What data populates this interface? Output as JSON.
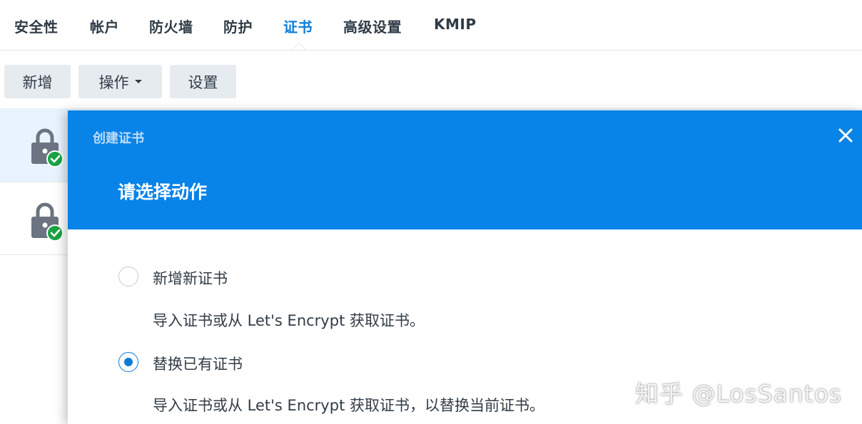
{
  "tabs": [
    {
      "label": "安全性"
    },
    {
      "label": "帐户"
    },
    {
      "label": "防火墙"
    },
    {
      "label": "防护"
    },
    {
      "label": "证书",
      "active": true
    },
    {
      "label": "高级设置"
    },
    {
      "label": "KMIP"
    }
  ],
  "toolbar": {
    "add_label": "新增",
    "action_label": "操作",
    "settings_label": "设置"
  },
  "list": {
    "items": [
      {
        "icon": "lock-check-icon",
        "selected": true
      },
      {
        "icon": "lock-check-icon",
        "selected": false
      }
    ]
  },
  "dialog": {
    "label": "创建证书",
    "title": "请选择动作",
    "close_icon": "close-icon",
    "options": [
      {
        "label": "新增新证书",
        "description": "导入证书或从 Let's Encrypt 获取证书。",
        "checked": false
      },
      {
        "label": "替换已有证书",
        "description": "导入证书或从 Let's Encrypt 获取证书，以替换当前证书。",
        "checked": true
      }
    ]
  },
  "watermark": "知乎 @LosSantos",
  "colors": {
    "accent": "#0a7cd8",
    "header_blue": "#0883e8",
    "selected_row": "#e8f3fd",
    "button_bg": "#e6ebf0",
    "lock_grey": "#6b7480",
    "check_green": "#1aa345"
  }
}
